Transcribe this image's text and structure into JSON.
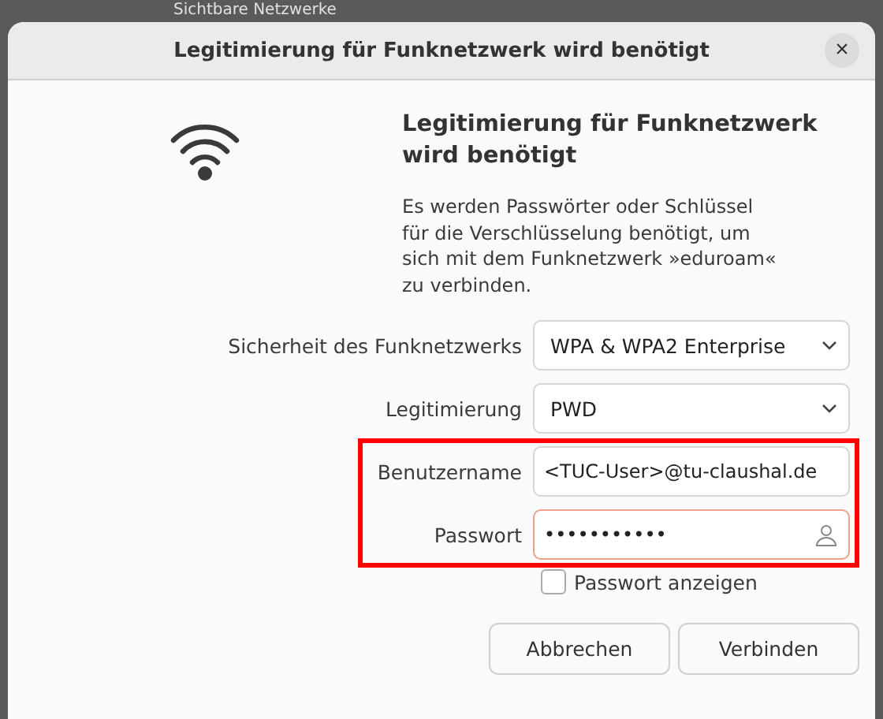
{
  "background_window": {
    "heading": "Sichtbare Netzwerke"
  },
  "window": {
    "title": "Legitimierung für Funknetzwerk wird benötigt",
    "close": "×"
  },
  "heading": "Legitimierung für Funknetzwerk wird benötigt",
  "message": "Es werden Passwörter oder Schlüssel für die Verschlüsselung benötigt, um sich mit dem Funknetzwerk »eduroam« zu verbinden.",
  "fields": [
    {
      "kind": "dropdown",
      "label": "Sicherheit des Funknetzwerks",
      "value": "WPA & WPA2 Enterprise",
      "highlighted": false,
      "focused": false
    },
    {
      "kind": "dropdown",
      "label": "Legitimierung",
      "value": "PWD",
      "highlighted": false,
      "focused": false
    },
    {
      "kind": "text",
      "label": "Benutzername",
      "value": "<TUC-User>@tu-claushal.de",
      "highlighted": true,
      "focused": false
    },
    {
      "kind": "password",
      "label": "Passwort",
      "value": "•••••••••••",
      "highlighted": true,
      "focused": true
    }
  ],
  "show_password": {
    "label": "Passwort anzeigen",
    "checked": false
  },
  "buttons": [
    "Abbrechen",
    "Verbinden"
  ]
}
